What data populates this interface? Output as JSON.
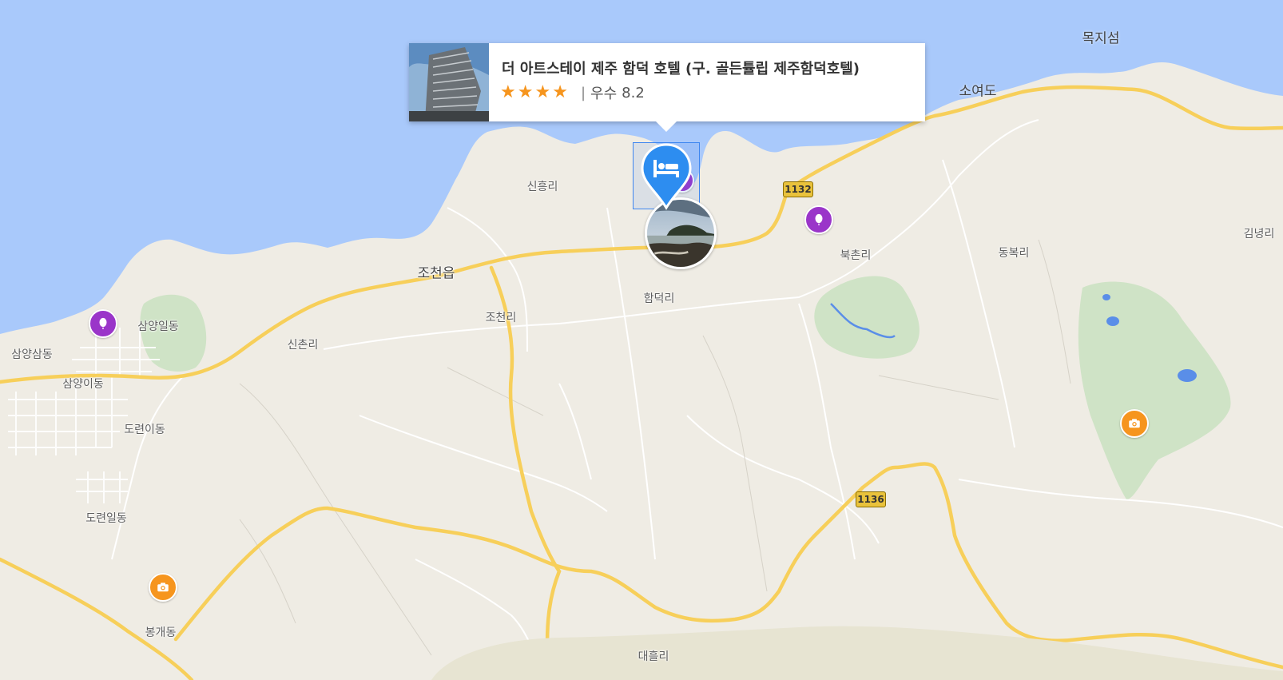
{
  "map": {
    "colors": {
      "sea": "#a9c9fb",
      "land": "#efece4",
      "major_road": "#f7cf5a",
      "minor_road": "#ffffff",
      "park": "#cfe3c6",
      "water_small": "#5a8ee8"
    },
    "place_labels": [
      {
        "text": "목지섬",
        "kind": "island"
      },
      {
        "text": "소여도",
        "kind": "island"
      },
      {
        "text": "신흥리",
        "kind": "town"
      },
      {
        "text": "조천읍",
        "kind": "big"
      },
      {
        "text": "북촌리",
        "kind": "town"
      },
      {
        "text": "동복리",
        "kind": "town"
      },
      {
        "text": "김녕리",
        "kind": "town"
      },
      {
        "text": "함덕리",
        "kind": "town"
      },
      {
        "text": "조천리",
        "kind": "town"
      },
      {
        "text": "신촌리",
        "kind": "town"
      },
      {
        "text": "삼양일동",
        "kind": "town"
      },
      {
        "text": "삼양삼동",
        "kind": "town"
      },
      {
        "text": "삼양이동",
        "kind": "town"
      },
      {
        "text": "도련이동",
        "kind": "town"
      },
      {
        "text": "도련일동",
        "kind": "town"
      },
      {
        "text": "봉개동",
        "kind": "town"
      },
      {
        "text": "대흘리",
        "kind": "town"
      }
    ],
    "route_shields": [
      {
        "label": "1132"
      },
      {
        "label": "1136"
      }
    ],
    "poi_markers": [
      {
        "type": "purple",
        "icon": "balloon-icon"
      },
      {
        "type": "purple",
        "icon": "balloon-icon"
      },
      {
        "type": "orange",
        "icon": "camera-icon"
      },
      {
        "type": "orange",
        "icon": "camera-icon"
      }
    ]
  },
  "popup": {
    "title": "더 아트스테이 제주 함덕 호텔 (구. 골든튤립 제주함덕호텔)",
    "stars": 4,
    "separator": "|",
    "grade": "우수",
    "score": "8.2"
  },
  "hotel_marker": {
    "icon": "bed-icon",
    "color": "#2d8df0"
  }
}
